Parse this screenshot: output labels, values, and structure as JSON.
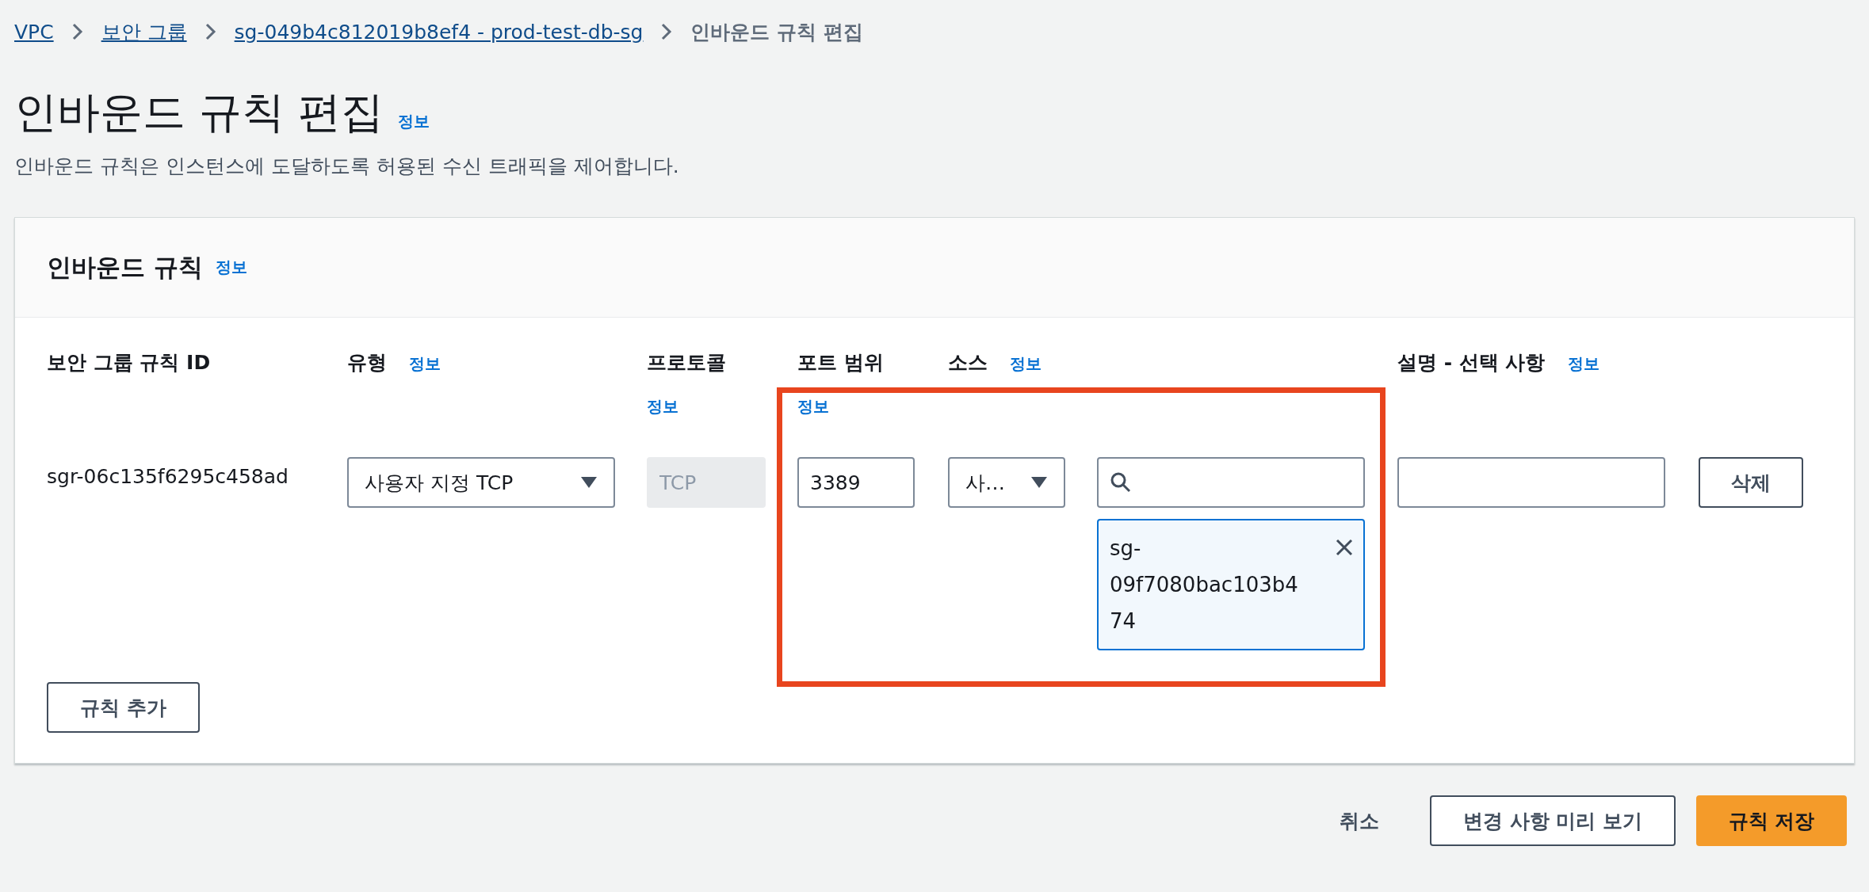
{
  "breadcrumbs": [
    {
      "label": "VPC",
      "current": false
    },
    {
      "label": "보안 그룹",
      "current": false
    },
    {
      "label": "sg-049b4c812019b8ef4 - prod-test-db-sg",
      "current": false
    },
    {
      "label": "인바운드 규칙 편집",
      "current": true
    }
  ],
  "page": {
    "title": "인바운드 규칙 편집",
    "info": "정보",
    "description": "인바운드 규칙은 인스턴스에 도달하도록 허용된 수신 트래픽을 제어합니다."
  },
  "panel": {
    "title": "인바운드 규칙",
    "info": "정보",
    "columns": [
      {
        "label": "보안 그룹 규칙 ID"
      },
      {
        "label": "유형",
        "info": "정보"
      },
      {
        "label": "프로토콜",
        "info": "정보"
      },
      {
        "label": "포트 범위",
        "info": "정보"
      },
      {
        "label": "소스",
        "info": "정보"
      },
      {
        "label": "설명 - 선택 사항",
        "info": "정보"
      }
    ],
    "rules": [
      {
        "id": "sgr-06c135f6295c458ad",
        "type": "사용자 지정 TCP",
        "protocol": "TCP",
        "protocol_disabled": true,
        "port": "3389",
        "source_type": "사…",
        "source_tokens": [
          "sg-09f7080bac103b474"
        ],
        "delete": "삭제"
      }
    ],
    "add_button": "규칙 추가"
  },
  "footer": {
    "cancel": "취소",
    "preview": "변경 사항 미리 보기",
    "save": "규칙 저장"
  }
}
